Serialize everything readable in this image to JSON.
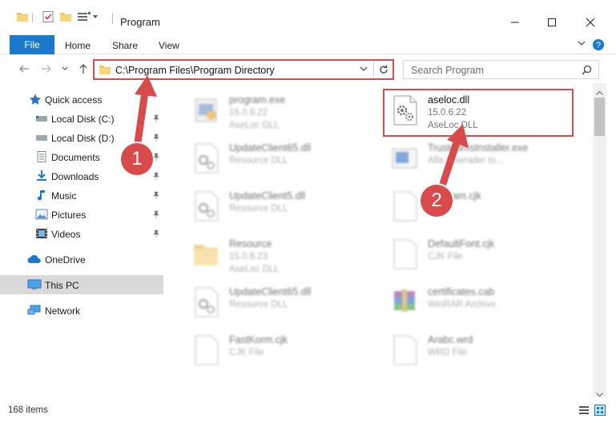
{
  "window": {
    "title": "Program"
  },
  "ribbon": {
    "tabs": [
      "File",
      "Home",
      "Share",
      "View"
    ]
  },
  "address": {
    "path": "C:\\Program Files\\Program Directory"
  },
  "search": {
    "placeholder": "Search Program"
  },
  "sidebar": {
    "items": [
      {
        "label": "Quick access",
        "icon": "star-icon"
      },
      {
        "label": "Local Disk (C:)",
        "icon": "drive-icon",
        "pinned": true
      },
      {
        "label": "Local Disk (D:)",
        "icon": "drive-icon",
        "pinned": true
      },
      {
        "label": "Documents",
        "icon": "documents-icon",
        "pinned": true
      },
      {
        "label": "Downloads",
        "icon": "download-icon",
        "pinned": true
      },
      {
        "label": "Music",
        "icon": "music-icon",
        "pinned": true
      },
      {
        "label": "Pictures",
        "icon": "pictures-icon",
        "pinned": true
      },
      {
        "label": "Videos",
        "icon": "videos-icon",
        "pinned": true
      },
      {
        "label": "OneDrive",
        "icon": "cloud-icon"
      },
      {
        "label": "This PC",
        "icon": "computer-icon"
      },
      {
        "label": "Network",
        "icon": "network-icon"
      }
    ]
  },
  "files": [
    {
      "name": "program.exe",
      "line1": "15.0.6.22",
      "line2": "AseLoc DLL",
      "icon": "exe-icon"
    },
    {
      "name": "aseloc.dll",
      "line1": "15.0.6.22",
      "line2": "AseLoc DLL",
      "icon": "dll-gear-icon"
    },
    {
      "name": "UpdateClient65.dll",
      "line1": "Resource DLL",
      "line2": "",
      "icon": "dll-gear-icon"
    },
    {
      "name": "TrustedmsInstaller.exe",
      "line1": "Alfa Bowrader to...",
      "line2": "",
      "icon": "window-icon"
    },
    {
      "name": "UpdateClient5.dll",
      "line1": "Resource DLL",
      "line2": "",
      "icon": "dll-gear-icon"
    },
    {
      "name": "Program.cjk",
      "line1": "",
      "line2": "",
      "icon": "blank-file-icon"
    },
    {
      "name": "Resource",
      "line1": "15.0.6.23",
      "line2": "AseLoc DLL",
      "icon": "folder-icon"
    },
    {
      "name": "DefaultFont.cjk",
      "line1": "CJK File",
      "line2": "",
      "icon": "blank-file-icon"
    },
    {
      "name": "UpdateClient65.dll",
      "line1": "Resource DLL",
      "line2": "",
      "icon": "dll-gear-icon"
    },
    {
      "name": "certificates.cab",
      "line1": "WinRAR Archive",
      "line2": "",
      "icon": "archive-icon"
    },
    {
      "name": "FastKorm.cjk",
      "line1": "CJK File",
      "line2": "",
      "icon": "blank-file-icon"
    },
    {
      "name": "Arabc.wrd",
      "line1": "WRD File",
      "line2": "",
      "icon": "blank-file-icon"
    }
  ],
  "status": {
    "text": "168 items"
  },
  "callouts": [
    "1",
    "2"
  ],
  "colors": {
    "accent": "#1979ca",
    "highlight": "#d94a4a",
    "selection": "#cce8ff"
  }
}
